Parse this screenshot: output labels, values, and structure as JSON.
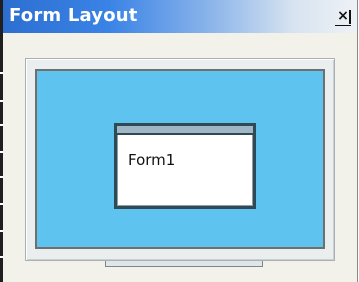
{
  "window": {
    "title": "Form Layout",
    "close_glyph": "×"
  },
  "preview": {
    "form_name": "Form1"
  },
  "colors": {
    "titlebar_start": "#2c6fd1",
    "titlebar_end": "#eef2f6",
    "screen": "#5ec3ee",
    "monitor_frame": "#eaeeee",
    "form_border": "#2f4a55"
  }
}
